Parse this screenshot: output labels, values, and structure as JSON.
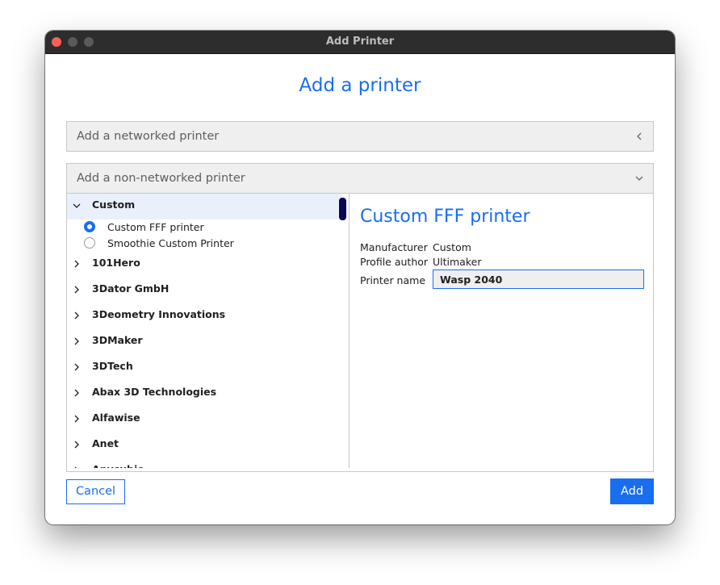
{
  "window": {
    "title": "Add Printer"
  },
  "dialog": {
    "heading": "Add a printer"
  },
  "sections": {
    "networked": {
      "label": "Add a networked printer",
      "icon": "chevron-left-icon"
    },
    "non_networked": {
      "label": "Add a non-networked printer",
      "icon": "chevron-down-icon"
    }
  },
  "tree": {
    "selected_group": {
      "label": "Custom",
      "icon": "chevron-down-icon"
    },
    "options": [
      {
        "label": "Custom FFF printer",
        "checked": true
      },
      {
        "label": "Smoothie Custom Printer",
        "checked": false
      }
    ],
    "groups": [
      {
        "label": "101Hero"
      },
      {
        "label": "3Dator GmbH"
      },
      {
        "label": "3Deometry Innovations"
      },
      {
        "label": "3DMaker"
      },
      {
        "label": "3DTech"
      },
      {
        "label": "Abax 3D Technologies"
      },
      {
        "label": "Alfawise"
      },
      {
        "label": "Anet"
      },
      {
        "label": "Anycubic"
      }
    ]
  },
  "details": {
    "title": "Custom FFF printer",
    "manufacturer_label": "Manufacturer",
    "manufacturer_value": "Custom",
    "author_label": "Profile author",
    "author_value": "Ultimaker",
    "name_label": "Printer name",
    "name_value": "Wasp 2040"
  },
  "buttons": {
    "cancel": "Cancel",
    "add": "Add"
  },
  "colors": {
    "accent": "#196ef0",
    "selected_row": "#e9f0fc",
    "scrollbar": "#0a0850"
  }
}
